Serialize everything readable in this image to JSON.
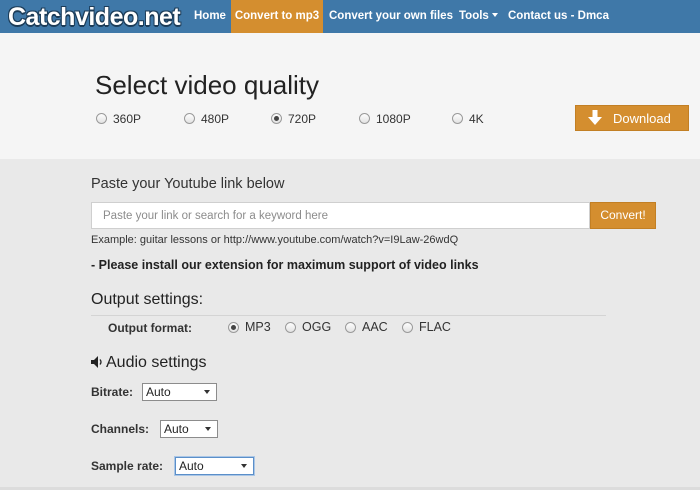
{
  "navbar": {
    "brand": "Catchvideo.net",
    "items": [
      {
        "label": "Home"
      },
      {
        "label": "Convert to mp3"
      },
      {
        "label": "Convert your own files"
      },
      {
        "label": "Tools"
      },
      {
        "label": "Contact us - Dmca"
      }
    ]
  },
  "quality": {
    "title": "Select video quality",
    "options": [
      {
        "label": "360P"
      },
      {
        "label": "480P"
      },
      {
        "label": "720P"
      },
      {
        "label": "1080P"
      },
      {
        "label": "4K"
      }
    ],
    "selected": "720P",
    "download_label": "Download"
  },
  "link": {
    "label": "Paste your Youtube link below",
    "placeholder": "Paste your link or search for a keyword here",
    "value": "",
    "convert_label": "Convert!",
    "example": "Example: guitar lessons or http://www.youtube.com/watch?v=I9Law-26wdQ",
    "notice": "- Please install our extension for maximum support of video links"
  },
  "output": {
    "heading": "Output settings:",
    "format_label": "Output format:",
    "formats": [
      {
        "label": "MP3"
      },
      {
        "label": "OGG"
      },
      {
        "label": "AAC"
      },
      {
        "label": "FLAC"
      }
    ],
    "selected": "MP3"
  },
  "audio": {
    "heading": "Audio settings",
    "bitrate_label": "Bitrate:",
    "bitrate_value": "Auto",
    "channels_label": "Channels:",
    "channels_value": "Auto",
    "samplerate_label": "Sample rate:",
    "samplerate_value": "Auto"
  },
  "colors": {
    "nav_bg": "#3f78a8",
    "accent": "#d48e2f",
    "page_bg": "#e9e9e9",
    "band_bg": "#f5f5f5"
  },
  "icons": {
    "download": "download-arrow-icon",
    "speaker": "speaker-icon",
    "caret": "caret-down-icon"
  }
}
